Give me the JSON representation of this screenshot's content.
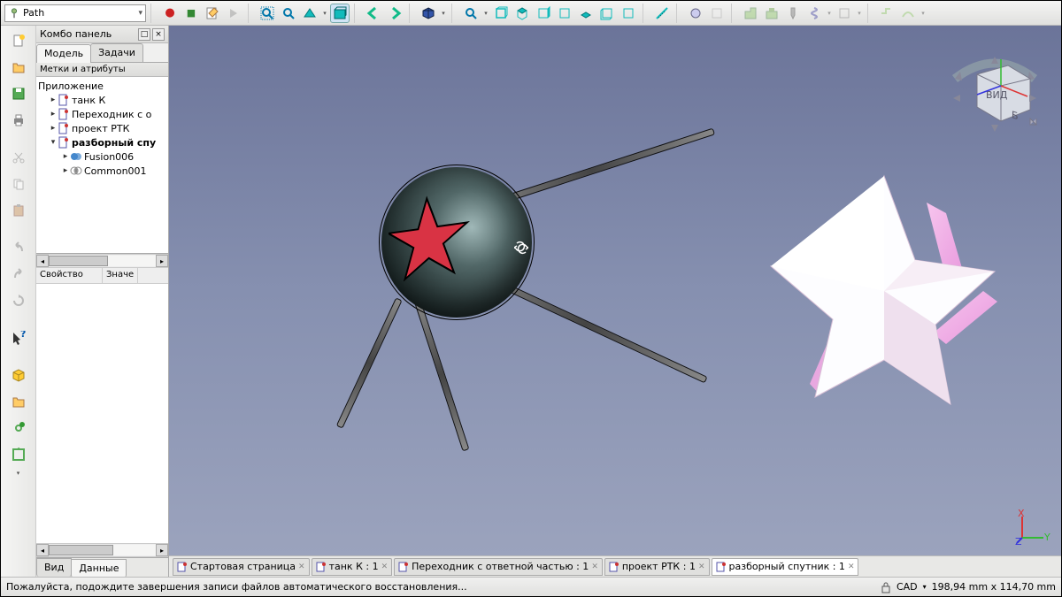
{
  "workbench": {
    "selected": "Path"
  },
  "combo": {
    "title": "Комбо панель",
    "tabs": {
      "model": "Модель",
      "tasks": "Задачи"
    },
    "labels_header": "Метки и атрибуты",
    "tree": {
      "root": "Приложение",
      "items": [
        {
          "label": "танк К",
          "icon": "part"
        },
        {
          "label": "Переходник с о",
          "icon": "part"
        },
        {
          "label": "проект РТК",
          "icon": "part"
        },
        {
          "label": "разборный спу",
          "icon": "part",
          "bold": true,
          "expanded": true,
          "children": [
            {
              "label": "Fusion006",
              "icon": "fusion"
            },
            {
              "label": "Common001",
              "icon": "common"
            }
          ]
        }
      ]
    },
    "prop": {
      "col1": "Свойство",
      "col2": "Значе"
    },
    "bottom_tabs": {
      "view": "Вид",
      "data": "Данные"
    }
  },
  "doc_tabs": [
    {
      "label": "Стартовая страница",
      "active": false
    },
    {
      "label": "танк К : 1",
      "active": false
    },
    {
      "label": "Переходник с ответной частью : 1",
      "active": false
    },
    {
      "label": "проект РТК : 1",
      "active": false
    },
    {
      "label": "разборный спутник : 1",
      "active": true
    }
  ],
  "status": {
    "message": "Пожалуйста, подождите завершения записи файлов автоматического восстановления...",
    "mode": "CAD",
    "coords": "198,94 mm x 114,70 mm"
  },
  "icons": {
    "record": "●",
    "stop": "■"
  }
}
